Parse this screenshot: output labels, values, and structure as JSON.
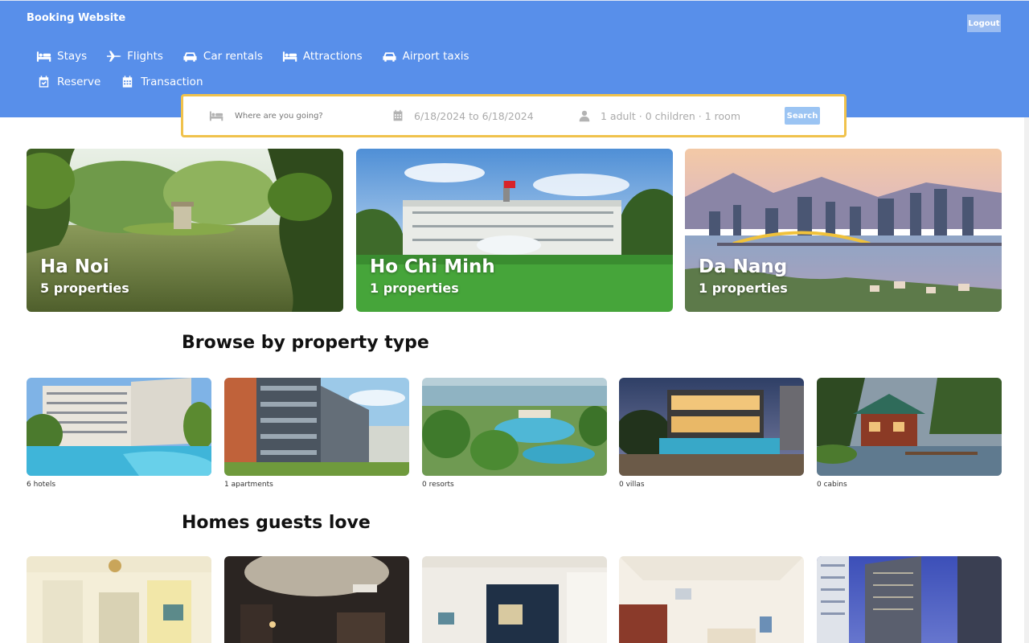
{
  "brand": "Booking Website",
  "logout_label": "Logout",
  "nav": {
    "row1": [
      {
        "label": "Stays",
        "icon": "bed-icon"
      },
      {
        "label": "Flights",
        "icon": "plane-icon"
      },
      {
        "label": "Car rentals",
        "icon": "car-icon"
      },
      {
        "label": "Attractions",
        "icon": "bed-icon"
      },
      {
        "label": "Airport taxis",
        "icon": "taxi-icon"
      }
    ],
    "row2": [
      {
        "label": "Reserve",
        "icon": "calendar-check-icon"
      },
      {
        "label": "Transaction",
        "icon": "calendar-icon"
      }
    ]
  },
  "search": {
    "placeholder": "Where are you going?",
    "dates": "6/18/2024 to 6/18/2024",
    "guests": "1 adult · 0 children · 1 room",
    "button": "Search"
  },
  "cities": [
    {
      "name": "Ha Noi",
      "properties": "5 properties"
    },
    {
      "name": "Ho Chi Minh",
      "properties": "1 properties"
    },
    {
      "name": "Da Nang",
      "properties": "1 properties"
    }
  ],
  "property_section_title": "Browse by property type",
  "property_types": [
    {
      "count": "6 hotels"
    },
    {
      "count": "1 apartments"
    },
    {
      "count": "0 resorts"
    },
    {
      "count": "0 villas"
    },
    {
      "count": "0 cabins"
    }
  ],
  "homes_section_title": "Homes guests love",
  "colors": {
    "header": "#588fea",
    "search_border": "#f0c24c",
    "search_button": "#9bc4f3"
  }
}
